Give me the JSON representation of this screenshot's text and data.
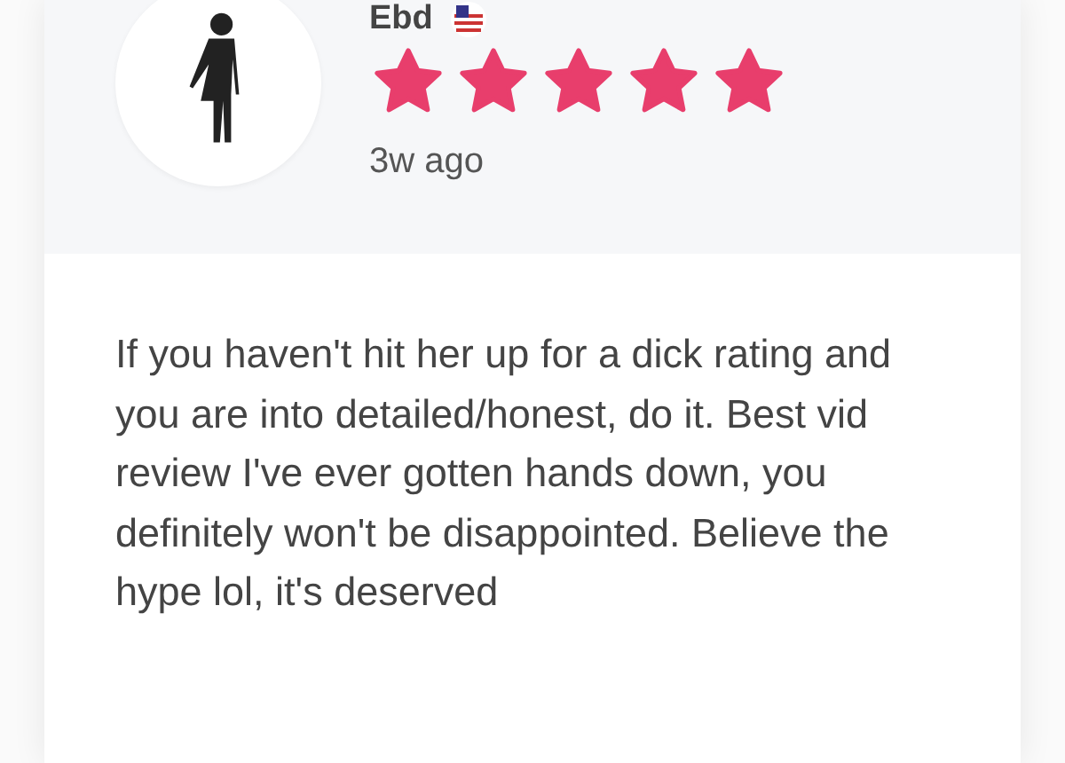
{
  "review": {
    "author": "Ebd",
    "stars": 5,
    "time": "3w ago",
    "text": "If you haven't hit her up for a dick rating and you are into detailed/honest, do it. Best vid review I've ever gotten hands down, you definitely won't be disappointed. Believe the hype lol, it's deserved"
  }
}
